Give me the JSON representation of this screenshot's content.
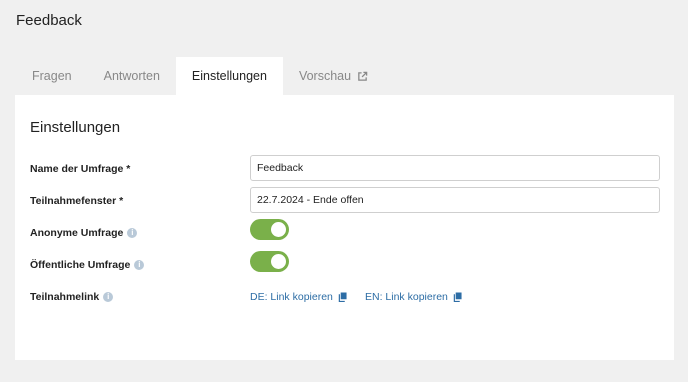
{
  "page": {
    "title": "Feedback"
  },
  "tabs": [
    {
      "label": "Fragen"
    },
    {
      "label": "Antworten"
    },
    {
      "label": "Einstellungen"
    },
    {
      "label": "Vorschau"
    }
  ],
  "settings": {
    "title": "Einstellungen",
    "name_label": "Name der Umfrage *",
    "name_value": "Feedback",
    "window_label": "Teilnahmefenster *",
    "window_value": "22.7.2024 - Ende offen",
    "anonymous_label": "Anonyme Umfrage",
    "anonymous_on": true,
    "public_label": "Öffentliche Umfrage",
    "public_on": true,
    "link_label": "Teilnahmelink",
    "link_de": "DE: Link kopieren",
    "link_en": "EN: Link kopieren",
    "info_glyph": "i"
  },
  "colors": {
    "accent_green": "#7ab04a",
    "link_blue": "#2d6da5",
    "background": "#f0f0f0"
  },
  "icons": {
    "vorschau": "external-link-icon",
    "copy": "copy-icon",
    "info": "info-icon"
  }
}
